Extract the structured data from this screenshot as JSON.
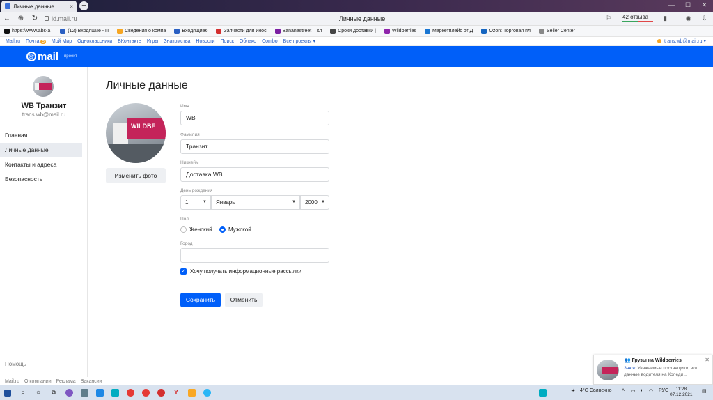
{
  "browser": {
    "tab_title": "Личные данные",
    "tab_close": "×",
    "new_tab": "+",
    "url": "id.mail.ru",
    "page_title": "Личные данные",
    "reviews_label": "42 отзыва",
    "back": "←",
    "reload": "↻"
  },
  "bookmarks": [
    {
      "label": "https://www.abs-a",
      "color": "#111111"
    },
    {
      "label": "(12) Входящие - П",
      "color": "#2a5fc2"
    },
    {
      "label": "Сведения о компа",
      "color": "#f6a623"
    },
    {
      "label": "Входящие6",
      "color": "#2a5fc2"
    },
    {
      "label": "Запчасти для инос",
      "color": "#d32f2f"
    },
    {
      "label": "Bananastreet – кл",
      "color": "#7b1fa2"
    },
    {
      "label": "Сроки доставки |",
      "color": "#444444"
    },
    {
      "label": "Wildberries",
      "color": "#8e24aa"
    },
    {
      "label": "Маркетплейс от Д",
      "color": "#1976d2"
    },
    {
      "label": "Ozon: Торговая пл",
      "color": "#1565c0"
    },
    {
      "label": "Seller Center",
      "color": "#888888"
    }
  ],
  "mail_nav": {
    "items": [
      "Mail.ru",
      "Почта",
      "Мой Мир",
      "Одноклассники",
      "ВКонтакте",
      "Игры",
      "Знакомства",
      "Новости",
      "Поиск",
      "Облако",
      "Combo",
      "Все проекты ▾"
    ],
    "mail_badge": "5",
    "user": "trans.wb@mail.ru ▾"
  },
  "header": {
    "logo": "mail",
    "project": "проект"
  },
  "profile": {
    "name": "WB Транзит",
    "email": "trans.wb@mail.ru"
  },
  "sidebar": {
    "items": [
      {
        "label": "Главная"
      },
      {
        "label": "Личные данные"
      },
      {
        "label": "Контакты и адреса"
      },
      {
        "label": "Безопасность"
      }
    ],
    "help": "Помощь"
  },
  "main": {
    "title": "Личные данные",
    "avatar_text": "WILDBE",
    "change_photo": "Изменить фото",
    "fields": {
      "first_name_label": "Имя",
      "first_name": "WB",
      "last_name_label": "Фамилия",
      "last_name": "Транзит",
      "nickname_label": "Никнейм",
      "nickname": "Доставка WB",
      "birthday_label": "День рождения",
      "day": "1",
      "month": "Январь",
      "year": "2000",
      "gender_label": "Пол",
      "female": "Женский",
      "male": "Мужской",
      "city_label": "Город",
      "city": "",
      "newsletter": "Хочу получать информационные рассылки"
    },
    "save": "Сохранить",
    "cancel": "Отменить"
  },
  "footer": [
    "Mail.ru",
    "О компании",
    "Реклама",
    "Вакансии"
  ],
  "notification": {
    "title": "Грузы на Wildberries",
    "sender": "Знюя:",
    "text": "Уважаемые поставщики, вот данные водителя на Коледи..."
  },
  "taskbar": {
    "weather": "4°C Солнечно",
    "lang": "РУС",
    "time": "11:28",
    "date": "07.12.2021"
  }
}
